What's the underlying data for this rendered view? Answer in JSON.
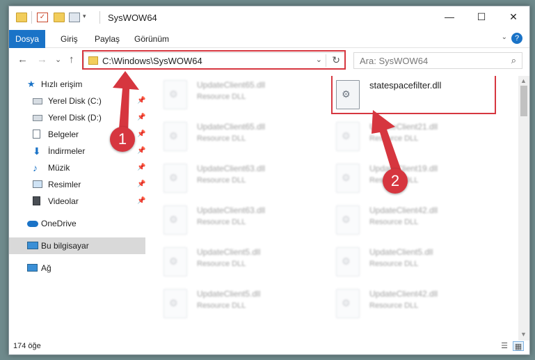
{
  "window": {
    "title": "SysWOW64",
    "controls": {
      "minimize": "—",
      "maximize": "☐",
      "close": "✕"
    }
  },
  "ribbon": {
    "tabs": [
      "Dosya",
      "Giriş",
      "Paylaş",
      "Görünüm"
    ],
    "expand_glyph": "⌄",
    "help_glyph": "?"
  },
  "nav": {
    "back_glyph": "←",
    "forward_glyph": "→",
    "recent_glyph": "⌄",
    "up_glyph": "↑",
    "address": "C:\\Windows\\SysWOW64",
    "address_dropdown_glyph": "⌄",
    "refresh_glyph": "↻",
    "search_placeholder": "Ara: SysWOW64",
    "search_glyph": "⌕"
  },
  "sidebar": {
    "items": [
      {
        "label": "Hızlı erişim",
        "icon": "star-icon"
      },
      {
        "label": "Yerel Disk (C:)",
        "icon": "drive-icon",
        "pinned": true
      },
      {
        "label": "Yerel Disk (D:)",
        "icon": "drive-icon",
        "pinned": true
      },
      {
        "label": "Belgeler",
        "icon": "documents-icon",
        "pinned": true
      },
      {
        "label": "İndirmeler",
        "icon": "download-icon",
        "pinned": true
      },
      {
        "label": "Müzik",
        "icon": "music-icon",
        "pinned": true
      },
      {
        "label": "Resimler",
        "icon": "pictures-icon",
        "pinned": true
      },
      {
        "label": "Videolar",
        "icon": "videos-icon",
        "pinned": true
      },
      {
        "label": "OneDrive",
        "icon": "onedrive-icon"
      },
      {
        "label": "Bu bilgisayar",
        "icon": "this-pc-icon",
        "selected": true
      },
      {
        "label": "Ağ",
        "icon": "network-icon"
      }
    ],
    "pin_glyph": "📌"
  },
  "files": {
    "left": [
      {
        "name": "UpdateClient65.dll",
        "desc": "Resource DLL"
      },
      {
        "name": "UpdateClient65.dll",
        "desc": "Resource DLL"
      },
      {
        "name": "UpdateClient63.dll",
        "desc": "Resource DLL"
      },
      {
        "name": "UpdateClient63.dll",
        "desc": "Resource DLL"
      },
      {
        "name": "UpdateClient5.dll",
        "desc": "Resource DLL"
      },
      {
        "name": "UpdateClient5.dll",
        "desc": "Resource DLL"
      }
    ],
    "right": [
      {
        "name": "statespacefilter.dll",
        "desc": "",
        "highlighted": true
      },
      {
        "name": "UpdateClient21.dll",
        "desc": "Resource DLL"
      },
      {
        "name": "UpdateClient19.dll",
        "desc": "Resource DLL"
      },
      {
        "name": "UpdateClient42.dll",
        "desc": "Resource DLL"
      },
      {
        "name": "UpdateClient5.dll",
        "desc": "Resource DLL"
      },
      {
        "name": "UpdateClient42.dll",
        "desc": "Resource DLL"
      }
    ],
    "gear_glyph": "⚙"
  },
  "status": {
    "count": "174 öğe",
    "details_view_glyph": "☰",
    "tiles_view_glyph": "▦"
  },
  "callouts": {
    "one": "1",
    "two": "2"
  },
  "colors": {
    "accent": "#1a73c7",
    "callout": "#d6363f"
  }
}
